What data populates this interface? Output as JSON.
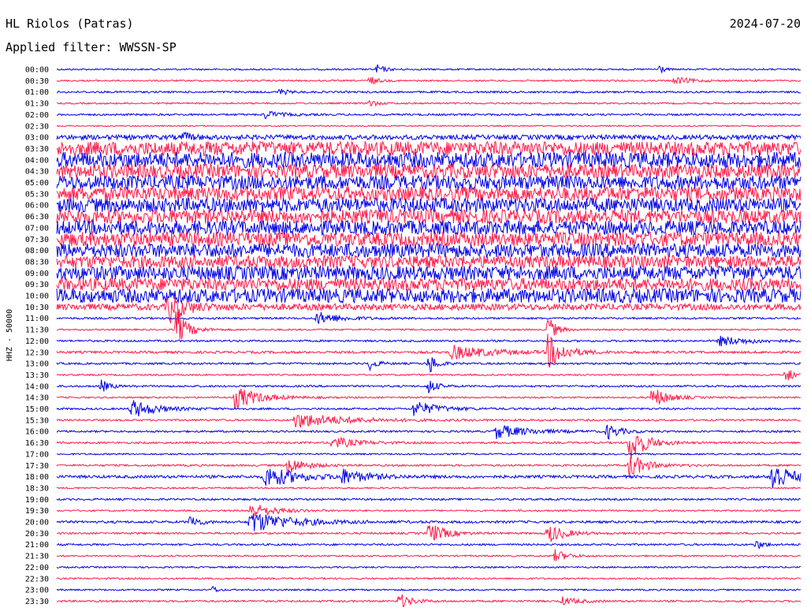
{
  "header": {
    "station": "HL Riolos (Patras)",
    "filter": "Applied filter: WWSSN-SP",
    "date": "2024-07-20"
  },
  "chart_data": {
    "type": "line",
    "title": "HL Riolos (Patras)",
    "ylabel": "HHZ - 50000",
    "colors": {
      "odd": "#0000e6",
      "even": "#ff1a4a"
    },
    "rows": [
      {
        "label": "00:00",
        "noise": 1,
        "events": [
          {
            "t": 0.43,
            "a": 6,
            "d": 0.01
          },
          {
            "t": 0.81,
            "a": 8,
            "d": 0.005
          }
        ]
      },
      {
        "label": "00:30",
        "noise": 1,
        "events": [
          {
            "t": 0.42,
            "a": 6,
            "d": 0.01
          },
          {
            "t": 0.83,
            "a": 5,
            "d": 0.02
          }
        ]
      },
      {
        "label": "01:00",
        "noise": 1.2,
        "events": [
          {
            "t": 0.3,
            "a": 4,
            "d": 0.01
          }
        ]
      },
      {
        "label": "01:30",
        "noise": 1,
        "events": [
          {
            "t": 0.42,
            "a": 5,
            "d": 0.01
          }
        ]
      },
      {
        "label": "02:00",
        "noise": 1.2,
        "events": [
          {
            "t": 0.28,
            "a": 5,
            "d": 0.02
          }
        ]
      },
      {
        "label": "02:30",
        "noise": 0.8,
        "events": []
      },
      {
        "label": "03:00",
        "noise": 3,
        "events": [
          {
            "t": 0.17,
            "a": 5,
            "d": 0.01
          }
        ]
      },
      {
        "label": "03:30",
        "noise": 9,
        "events": []
      },
      {
        "label": "04:00",
        "noise": 10,
        "events": []
      },
      {
        "label": "04:30",
        "noise": 9,
        "events": []
      },
      {
        "label": "05:00",
        "noise": 9,
        "events": []
      },
      {
        "label": "05:30",
        "noise": 9,
        "events": []
      },
      {
        "label": "06:00",
        "noise": 9,
        "events": []
      },
      {
        "label": "06:30",
        "noise": 9,
        "events": []
      },
      {
        "label": "07:00",
        "noise": 9,
        "events": []
      },
      {
        "label": "07:30",
        "noise": 9,
        "events": []
      },
      {
        "label": "08:00",
        "noise": 9,
        "events": []
      },
      {
        "label": "08:30",
        "noise": 8,
        "events": []
      },
      {
        "label": "09:00",
        "noise": 9,
        "events": []
      },
      {
        "label": "09:30",
        "noise": 8,
        "events": []
      },
      {
        "label": "10:00",
        "noise": 9,
        "events": []
      },
      {
        "label": "10:30",
        "noise": 4,
        "events": [
          {
            "t": 0.15,
            "a": 20,
            "d": 0.02
          }
        ]
      },
      {
        "label": "11:00",
        "noise": 1.2,
        "events": [
          {
            "t": 0.35,
            "a": 8,
            "d": 0.03
          }
        ]
      },
      {
        "label": "11:30",
        "noise": 1,
        "events": [
          {
            "t": 0.16,
            "a": 25,
            "d": 0.015
          },
          {
            "t": 0.66,
            "a": 18,
            "d": 0.01
          }
        ]
      },
      {
        "label": "12:00",
        "noise": 1.2,
        "events": [
          {
            "t": 0.89,
            "a": 6,
            "d": 0.04
          }
        ]
      },
      {
        "label": "12:30",
        "noise": 1.5,
        "events": [
          {
            "t": 0.53,
            "a": 9,
            "d": 0.05
          },
          {
            "t": 0.66,
            "a": 22,
            "d": 0.02
          }
        ]
      },
      {
        "label": "13:00",
        "noise": 1.2,
        "events": [
          {
            "t": 0.42,
            "a": 8,
            "d": 0.01
          },
          {
            "t": 0.5,
            "a": 14,
            "d": 0.01
          }
        ]
      },
      {
        "label": "13:30",
        "noise": 1,
        "events": [
          {
            "t": 0.98,
            "a": 10,
            "d": 0.01
          }
        ]
      },
      {
        "label": "14:00",
        "noise": 1.2,
        "events": [
          {
            "t": 0.06,
            "a": 8,
            "d": 0.01
          },
          {
            "t": 0.5,
            "a": 10,
            "d": 0.01
          }
        ]
      },
      {
        "label": "14:30",
        "noise": 1,
        "events": [
          {
            "t": 0.24,
            "a": 15,
            "d": 0.03
          },
          {
            "t": 0.8,
            "a": 14,
            "d": 0.02
          }
        ]
      },
      {
        "label": "15:00",
        "noise": 1.2,
        "events": [
          {
            "t": 0.1,
            "a": 12,
            "d": 0.03
          },
          {
            "t": 0.48,
            "a": 10,
            "d": 0.03
          }
        ]
      },
      {
        "label": "15:30",
        "noise": 1.2,
        "events": [
          {
            "t": 0.32,
            "a": 10,
            "d": 0.06
          }
        ]
      },
      {
        "label": "16:00",
        "noise": 1.2,
        "events": [
          {
            "t": 0.59,
            "a": 9,
            "d": 0.04
          },
          {
            "t": 0.74,
            "a": 10,
            "d": 0.015
          }
        ]
      },
      {
        "label": "16:30",
        "noise": 1.2,
        "events": [
          {
            "t": 0.37,
            "a": 8,
            "d": 0.03
          },
          {
            "t": 0.77,
            "a": 25,
            "d": 0.02
          }
        ]
      },
      {
        "label": "17:00",
        "noise": 1,
        "events": []
      },
      {
        "label": "17:30",
        "noise": 1.2,
        "events": [
          {
            "t": 0.31,
            "a": 12,
            "d": 0.02
          },
          {
            "t": 0.77,
            "a": 16,
            "d": 0.02
          }
        ]
      },
      {
        "label": "18:00",
        "noise": 1.8,
        "events": [
          {
            "t": 0.28,
            "a": 14,
            "d": 0.04
          },
          {
            "t": 0.38,
            "a": 10,
            "d": 0.03
          },
          {
            "t": 0.96,
            "a": 25,
            "d": 0.02
          }
        ]
      },
      {
        "label": "18:30",
        "noise": 1,
        "events": []
      },
      {
        "label": "19:00",
        "noise": 1.2,
        "events": []
      },
      {
        "label": "19:30",
        "noise": 1,
        "events": [
          {
            "t": 0.26,
            "a": 10,
            "d": 0.03
          }
        ]
      },
      {
        "label": "20:00",
        "noise": 1.5,
        "events": [
          {
            "t": 0.18,
            "a": 10,
            "d": 0.01
          },
          {
            "t": 0.26,
            "a": 14,
            "d": 0.05
          }
        ]
      },
      {
        "label": "20:30",
        "noise": 1.2,
        "events": [
          {
            "t": 0.5,
            "a": 14,
            "d": 0.02
          },
          {
            "t": 0.66,
            "a": 13,
            "d": 0.02
          }
        ]
      },
      {
        "label": "21:00",
        "noise": 1.2,
        "events": [
          {
            "t": 0.94,
            "a": 6,
            "d": 0.01
          }
        ]
      },
      {
        "label": "21:30",
        "noise": 1,
        "events": [
          {
            "t": 0.67,
            "a": 8,
            "d": 0.015
          }
        ]
      },
      {
        "label": "22:00",
        "noise": 1,
        "events": []
      },
      {
        "label": "22:30",
        "noise": 1,
        "events": []
      },
      {
        "label": "23:00",
        "noise": 1,
        "events": [
          {
            "t": 0.21,
            "a": 5,
            "d": 0.005
          }
        ]
      },
      {
        "label": "23:30",
        "noise": 1.2,
        "events": [
          {
            "t": 0.46,
            "a": 10,
            "d": 0.015
          },
          {
            "t": 0.68,
            "a": 5,
            "d": 0.02
          }
        ]
      }
    ]
  }
}
